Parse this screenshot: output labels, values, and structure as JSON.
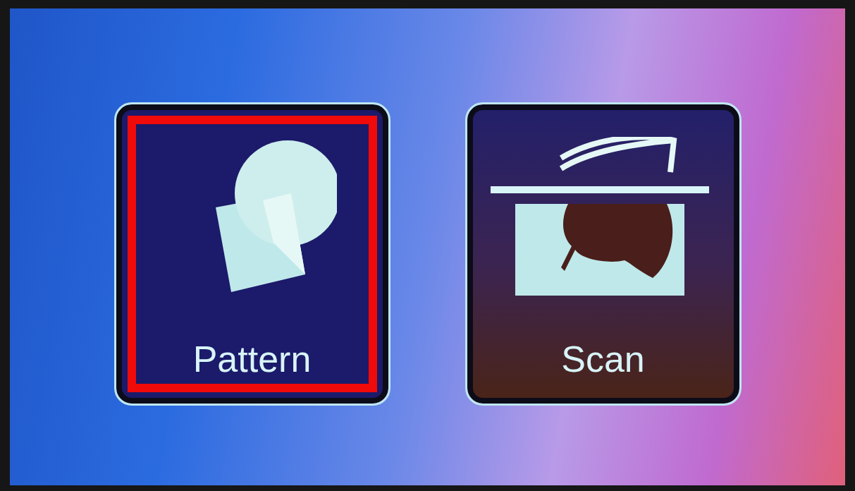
{
  "tiles": [
    {
      "label": "Pattern",
      "kind": "pattern",
      "selected": true
    },
    {
      "label": "Scan",
      "kind": "scan",
      "selected": false
    }
  ]
}
